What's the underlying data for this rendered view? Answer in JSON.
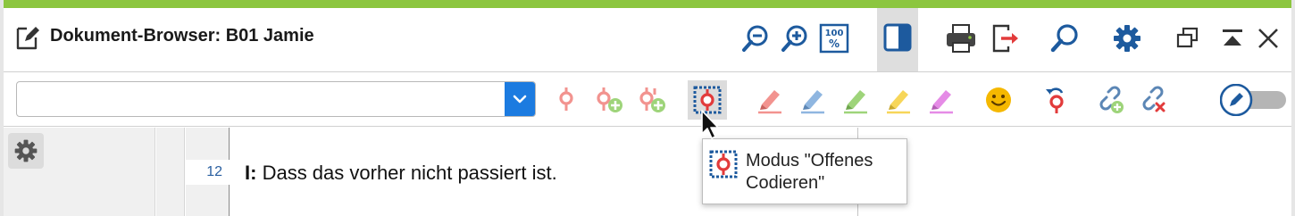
{
  "window": {
    "title": "Dokument-Browser: B01 Jamie",
    "accent_color": "#8cc63f",
    "icons": [
      "edit-document-icon",
      "zoom-out-icon",
      "zoom-in-icon",
      "zoom-100-icon",
      "panel-toggle-icon",
      "print-icon",
      "export-icon",
      "search-icon",
      "settings-gear-icon",
      "restore-window-icon",
      "collapse-icon",
      "close-icon"
    ]
  },
  "toolbar": {
    "search": {
      "value": "",
      "placeholder": ""
    },
    "tools": [
      "code-icon",
      "code-plus-icon",
      "code-multi-plus-icon",
      "open-coding-mode-icon",
      "highlighter-red-icon",
      "highlighter-blue-icon",
      "highlighter-green-icon",
      "highlighter-yellow-icon",
      "highlighter-magenta-icon",
      "emoticode-smiley-icon",
      "undo-code-icon",
      "link-add-icon",
      "link-remove-icon",
      "edit-mode-icon"
    ],
    "colors": {
      "code_red": "#e23b3b",
      "highlight_red": "#f2938f",
      "highlight_blue": "#8fb6e0",
      "highlight_green": "#9ed47a",
      "highlight_yellow": "#f7d659",
      "highlight_magenta": "#e58be6",
      "icon_blue": "#1d5a9e"
    },
    "edit_mode_on": false
  },
  "document": {
    "line_number": "12",
    "speaker": "I:",
    "text": " Dass das vorher nicht passiert ist."
  },
  "tooltip": {
    "text": "Modus \"Offenes Codieren\""
  }
}
